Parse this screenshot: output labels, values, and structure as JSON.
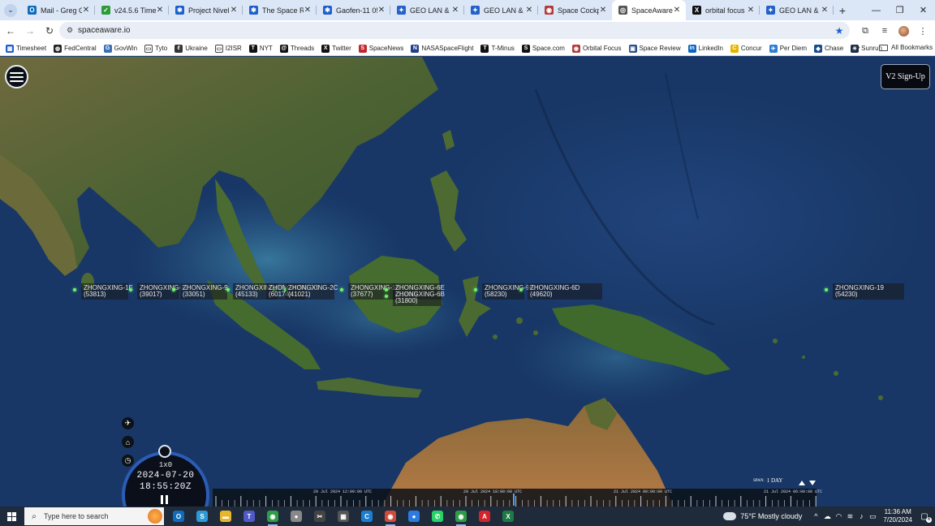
{
  "tabs": [
    {
      "title": "Mail - Greg Gil",
      "icon": "outlook-icon",
      "color": "#0f6cbd",
      "glyph": "O"
    },
    {
      "title": "v24.5.6 Time -",
      "icon": "check-icon",
      "color": "#2e9b3a",
      "glyph": "✓"
    },
    {
      "title": "Project Nivelir",
      "icon": "confluence-icon",
      "color": "#1f5fcc",
      "glyph": "✱"
    },
    {
      "title": "The Space Revi",
      "icon": "confluence-icon",
      "color": "#1f5fcc",
      "glyph": "✱"
    },
    {
      "title": "Gaofen-11 05",
      "icon": "confluence-icon",
      "color": "#1f5fcc",
      "glyph": "✱"
    },
    {
      "title": "GEO LAN & SI",
      "icon": "jira-icon",
      "color": "#2661c9",
      "glyph": "✦"
    },
    {
      "title": "GEO LAN & SI",
      "icon": "jira-icon",
      "color": "#2661c9",
      "glyph": "✦"
    },
    {
      "title": "Space Cockpit",
      "icon": "cockpit-icon",
      "color": "#b43a3a",
      "glyph": "◉"
    },
    {
      "title": "SpaceAware.io",
      "icon": "spaceaware-icon",
      "color": "#555555",
      "glyph": "◎",
      "active": true
    },
    {
      "title": "orbital focus -",
      "icon": "x-icon",
      "color": "#111111",
      "glyph": "X"
    },
    {
      "title": "GEO LAN & SI",
      "icon": "jira-icon",
      "color": "#2661c9",
      "glyph": "✦"
    }
  ],
  "browser": {
    "url": "spaceaware.io",
    "new_tab": "+",
    "close_glyph": "✕"
  },
  "bookmarks": [
    {
      "label": "Timesheet",
      "icon": "timesheet-icon",
      "color": "#1f5fcc",
      "glyph": "▦"
    },
    {
      "label": "FedCentral",
      "icon": "fedcentral-icon",
      "color": "#222222",
      "glyph": "◍"
    },
    {
      "label": "GovWin",
      "icon": "govwin-icon",
      "color": "#3a6fb5",
      "glyph": "G"
    },
    {
      "label": "Tyto",
      "icon": "folder-icon",
      "color": "#ffffff",
      "glyph": "▭"
    },
    {
      "label": "Ukraine",
      "icon": "ukraine-icon",
      "color": "#333333",
      "glyph": "ℓ"
    },
    {
      "label": "I2ISR",
      "icon": "folder-icon",
      "color": "#ffffff",
      "glyph": "▭"
    },
    {
      "label": "NYT",
      "icon": "nyt-icon",
      "color": "#111111",
      "glyph": "T"
    },
    {
      "label": "Threads",
      "icon": "threads-icon",
      "color": "#111111",
      "glyph": "@"
    },
    {
      "label": "Twitter",
      "icon": "x-icon",
      "color": "#111111",
      "glyph": "X"
    },
    {
      "label": "SpaceNews",
      "icon": "spacenews-icon",
      "color": "#c0262d",
      "glyph": "S"
    },
    {
      "label": "NASASpaceFlight",
      "icon": "nsf-icon",
      "color": "#233e8b",
      "glyph": "N"
    },
    {
      "label": "T-Minus",
      "icon": "tminus-icon",
      "color": "#111111",
      "glyph": "T"
    },
    {
      "label": "Space.com",
      "icon": "spacecom-icon",
      "color": "#111111",
      "glyph": "S"
    },
    {
      "label": "Orbital Focus",
      "icon": "orbital-focus-icon",
      "color": "#b43a3a",
      "glyph": "◉"
    },
    {
      "label": "Space Review",
      "icon": "space-review-icon",
      "color": "#2b4f8a",
      "glyph": "▣"
    },
    {
      "label": "LinkedIn",
      "icon": "linkedin-icon",
      "color": "#0a66c2",
      "glyph": "in"
    },
    {
      "label": "Concur",
      "icon": "concur-icon",
      "color": "#e6b400",
      "glyph": "C"
    },
    {
      "label": "Per Diem",
      "icon": "per-diem-icon",
      "color": "#2a7fd4",
      "glyph": "✈"
    },
    {
      "label": "Chase",
      "icon": "chase-icon",
      "color": "#1a4b8c",
      "glyph": "◆"
    },
    {
      "label": "Sunrun",
      "icon": "sunrun-icon",
      "color": "#1b2b4b",
      "glyph": "☀"
    }
  ],
  "bookmarks_all": "All Bookmarks",
  "app": {
    "signup_label": "V2 Sign-Up",
    "speed": "1x0",
    "date": "2024-07-20",
    "time": "18:55:20Z",
    "span_label": "SPAN:",
    "span_value": "1 DAY",
    "timeline_labels": [
      "20 Jul 2024 12:00:00 UTC",
      "20 Jul 2024 18:00:00 UTC",
      "21 Jul 2024 00:00:00 UTC",
      "21 Jul 2024 06:00:00 UTC"
    ]
  },
  "satellites": [
    {
      "name": "ZHONGXING-1E",
      "id": "(53813)"
    },
    {
      "name": "ZHONGXING-12",
      "id": "(39017)"
    },
    {
      "name": "ZHONGXING-9",
      "id": "(33051)"
    },
    {
      "name": "ZHONGXING-9A",
      "id": "(45133)"
    },
    {
      "name": "ZHONGXING-2C",
      "id": "(60174)"
    },
    {
      "name": "ZHONGXING-2C",
      "id": "(41021)"
    },
    {
      "name": "ZHONGXING-10",
      "id": "(37677)"
    },
    {
      "name": "ZHONGXING-6E",
      "id": "(31800)"
    },
    {
      "name": "ZHONGXING-6B",
      "id": "(31800)"
    },
    {
      "name": "ZHONGXING-9B",
      "id": "(58230)"
    },
    {
      "name": "ZHONGXING-6D",
      "id": "(49620)"
    },
    {
      "name": "ZHONGXING-19",
      "id": "(54230)"
    }
  ],
  "taskbar": {
    "search_placeholder": "Type here to search",
    "apps": [
      {
        "icon": "outlook-icon",
        "color": "#0f6cbd",
        "glyph": "O"
      },
      {
        "icon": "skype-icon",
        "color": "#2d9ad8",
        "glyph": "S"
      },
      {
        "icon": "file-explorer-icon",
        "color": "#e8b62b",
        "glyph": "▬"
      },
      {
        "icon": "teams-icon",
        "color": "#5059c9",
        "glyph": "T"
      },
      {
        "icon": "chrome-icon",
        "color": "#2d9d48",
        "glyph": "◉"
      },
      {
        "icon": "sphere-icon",
        "color": "#888888",
        "glyph": "●"
      },
      {
        "icon": "snip-icon",
        "color": "#444444",
        "glyph": "✂"
      },
      {
        "icon": "calculator-icon",
        "color": "#555555",
        "glyph": "▦"
      },
      {
        "icon": "edge-icon",
        "color": "#1b7fd1",
        "glyph": "C"
      },
      {
        "icon": "chrome-profile-icon",
        "color": "#d14b3b",
        "glyph": "◉"
      },
      {
        "icon": "webex-icon",
        "color": "#2d7be0",
        "glyph": "●"
      },
      {
        "icon": "whatsapp-icon",
        "color": "#25d366",
        "glyph": "✆"
      },
      {
        "icon": "chrome-alt-icon",
        "color": "#2d9d48",
        "glyph": "◉"
      },
      {
        "icon": "acrobat-icon",
        "color": "#d2242a",
        "glyph": "A"
      },
      {
        "icon": "excel-icon",
        "color": "#1d7a45",
        "glyph": "X"
      }
    ],
    "weather": "75°F  Mostly cloudy",
    "time": "11:36 AM",
    "date": "7/20/2024",
    "notifications": "6"
  }
}
